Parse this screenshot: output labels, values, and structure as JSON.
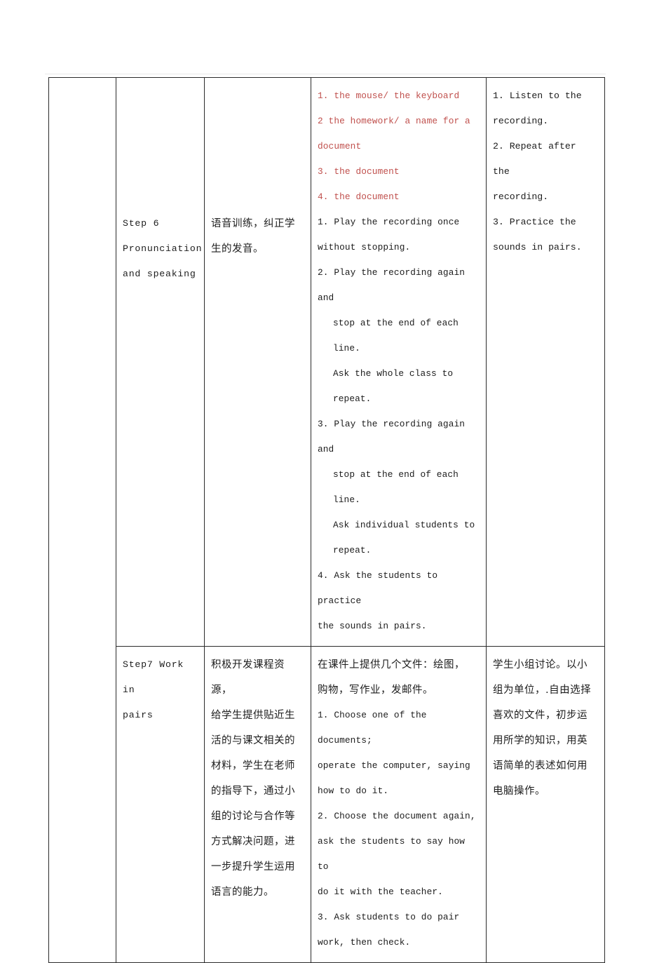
{
  "document": {
    "type": "lesson-plan-table",
    "columns": 5,
    "rows": 2,
    "red_accent": "#c0504d",
    "text_color": "#1c1c1c",
    "border_color": "#2b2b2b"
  },
  "row1": {
    "col1": "",
    "step_label": {
      "line1": "Step 6",
      "line2": "Pronunciation",
      "line3": "and speaking"
    },
    "purpose": {
      "line1": "语音训练，纠正学",
      "line2": "生的发音。"
    },
    "procedure": {
      "answers": [
        "1. the mouse/ the keyboard",
        "2 the homework/ a name for a",
        "document",
        "3. the document",
        "4. the document"
      ],
      "steps": [
        "1. Play the recording once",
        "without stopping.",
        "2. Play the recording again and",
        "stop at the end of each line.",
        "Ask the whole class to",
        "repeat.",
        "3. Play the recording again and",
        "stop at the end of each line.",
        "Ask individual students to",
        "repeat.",
        "4. Ask the students to practice",
        "the sounds in pairs."
      ]
    },
    "student_activity": [
      "1. Listen to the",
      "recording.",
      "2. Repeat after the",
      "recording.",
      "3. Practice the",
      "sounds in pairs."
    ]
  },
  "row2": {
    "step_label": {
      "line1": "Step7 Work in",
      "line2": "pairs"
    },
    "purpose": [
      "积极开发课程资源，",
      "给学生提供贴近生",
      "活的与课文相关的",
      "材料，学生在老师",
      "的指导下，通过小",
      "组的讨论与合作等",
      "方式解决问题，进",
      "一步提升学生运用",
      "语言的能力。"
    ],
    "procedure": {
      "intro": [
        "在课件上提供几个文件：绘图，",
        "购物，写作业，发邮件。"
      ],
      "steps": [
        "1. Choose one of the documents;",
        "operate the computer, saying",
        "how to do it.",
        "2. Choose the document again,",
        "ask the students to say how to",
        "do it with the teacher.",
        "3. Ask students to do pair",
        "work, then check."
      ]
    },
    "student_activity": [
      "学生小组讨论。以小",
      "组为单位，.自由选择",
      "喜欢的文件，初步运",
      "用所学的知识，用英",
      "语简单的表述如何用",
      "电脑操作。"
    ]
  }
}
